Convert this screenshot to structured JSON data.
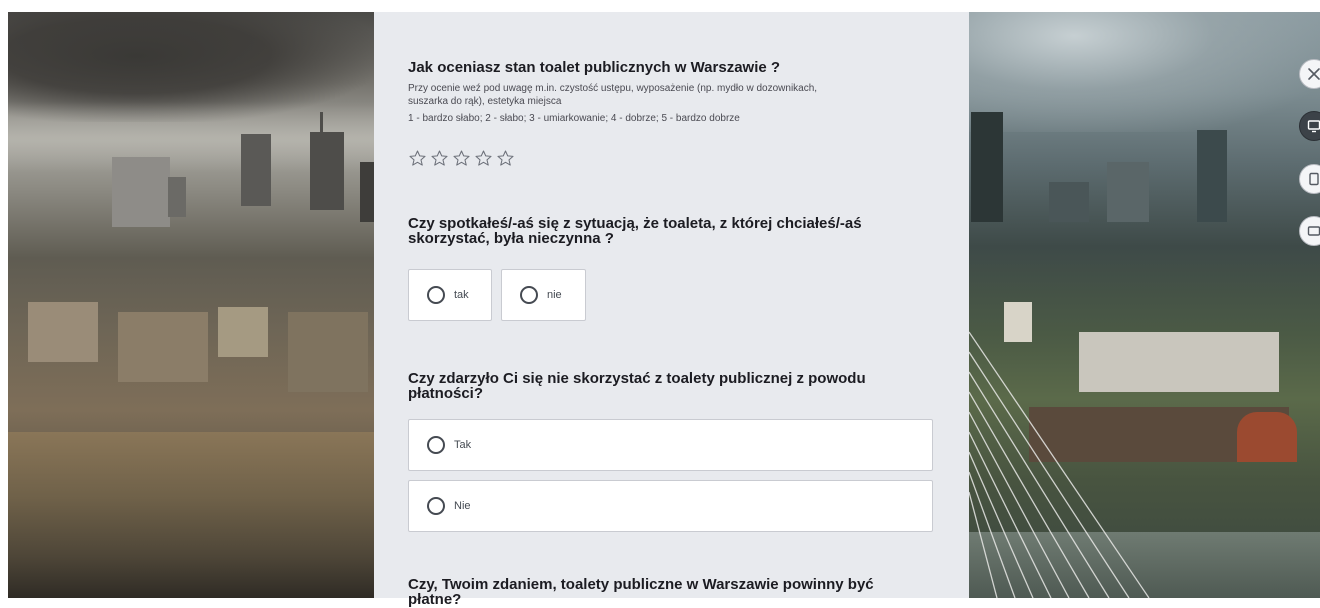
{
  "survey": {
    "questions": [
      {
        "title": "Jak oceniasz stan toalet publicznych w Warszawie ?",
        "description_line1": "Przy ocenie weź pod uwagę m.in. czystość ustępu, wyposażenie (np. mydło w dozownikach,",
        "description_line2": "suszarka do rąk), estetyka miejsca",
        "scale": "1 - bardzo słabo; 2 - słabo; 3 - umiarkowanie; 4 - dobrze; 5 - bardzo dobrze",
        "rating_max": 5,
        "rating_value": 0
      },
      {
        "title_line1": "Czy spotkałeś/-aś się z sytuacją, że toaleta, z której chciałeś/-aś",
        "title_line2": "skorzystać, była nieczynna ?",
        "options": [
          "tak",
          "nie"
        ]
      },
      {
        "title_line1": "Czy zdarzyło Ci się nie skorzystać z toalety publicznej z powodu",
        "title_line2": "płatności?",
        "options": [
          "Tak",
          "Nie"
        ]
      },
      {
        "title_line1": "Czy, Twoim zdaniem, toalety publiczne w Warszawie powinny być",
        "title_line2": "płatne?"
      }
    ]
  },
  "side_controls": [
    {
      "icon": "close-icon"
    },
    {
      "icon": "desktop-icon"
    },
    {
      "icon": "tablet-icon"
    },
    {
      "icon": "tablet-landscape-icon"
    }
  ],
  "colors": {
    "panel_bg": "#e8eaee",
    "text": "#1c1c22",
    "option_border": "#c9cbd1",
    "radio": "#454a52"
  }
}
